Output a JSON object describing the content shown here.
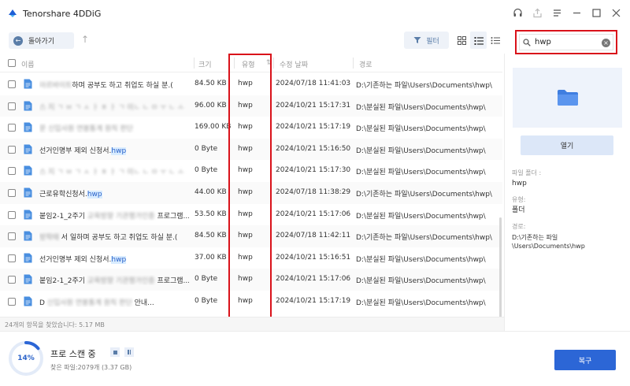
{
  "app": {
    "title": "Tenorshare 4DDiG"
  },
  "toolbar": {
    "back_label": "돌아가기",
    "filter_label": "필터"
  },
  "search": {
    "value": "hwp"
  },
  "table": {
    "headers": {
      "name": "이름",
      "size": "크기",
      "type": "유형",
      "date": "수정 날짜",
      "path": "경로"
    },
    "rows": [
      {
        "name_pre": "",
        "name_blur": "아르바이트",
        "name_post": "하며 공부도 하고 취업도 하실 분.(",
        "hl": "",
        "size": "84.50 KB",
        "type": "hwp",
        "date": "2024/07/18 11:41:03",
        "path": "D:\\기존하는 파일\\Users\\Documents\\hwp\\"
      },
      {
        "name_pre": "",
        "name_blur": "스 지 ㄱ ㅂ ㄱ ㅅ ㅏ ㅎ ㅏ ㄱ 이ㄴ ㄴ ㅁ ㅜ ㄴ ㅗ",
        "name_post": "",
        "hl": "",
        "size": "96.00 KB",
        "type": "hwp",
        "date": "2024/10/21 15:17:31",
        "path": "D:\\분실된 파일\\Users\\Documents\\hwp\\"
      },
      {
        "name_pre": "",
        "name_blur": "문 신입사원 연봉통계 원칙 판단",
        "name_post": "",
        "hl": "",
        "size": "169.00 KB",
        "type": "hwp",
        "date": "2024/10/21 15:17:19",
        "path": "D:\\분실된 파일\\Users\\Documents\\hwp\\"
      },
      {
        "name_pre": "선거인명부 제외 신청서.",
        "name_blur": "",
        "name_post": "",
        "hl": "hwp",
        "size": "0 Byte",
        "type": "hwp",
        "date": "2024/10/21 15:16:50",
        "path": "D:\\분실된 파일\\Users\\Documents\\hwp\\"
      },
      {
        "name_pre": "",
        "name_blur": "스 지 ㄱ ㅂ ㄱ ㅅ ㅏ ㅎ ㅏ ㄱ 이ㄴ ㄴ ㅁ ㅜ ㄴ ㅗ",
        "name_post": "",
        "hl": "",
        "size": "0 Byte",
        "type": "hwp",
        "date": "2024/10/21 15:17:30",
        "path": "D:\\분실된 파일\\Users\\Documents\\hwp\\"
      },
      {
        "name_pre": "근로유학신청서.",
        "name_blur": "",
        "name_post": "",
        "hl": "hwp",
        "size": "44.00 KB",
        "type": "hwp",
        "date": "2024/07/18 11:38:29",
        "path": "D:\\기존하는 파일\\Users\\Documents\\hwp\\"
      },
      {
        "name_pre": "붙임2-1_2주기",
        "name_blur": " 교육방향 기관평가인증",
        "name_post": " 프로그램...",
        "hl": "",
        "size": "53.50 KB",
        "type": "hwp",
        "date": "2024/10/21 15:17:06",
        "path": "D:\\분실된 파일\\Users\\Documents\\hwp\\"
      },
      {
        "name_pre": "",
        "name_blur": "방학때 ",
        "name_post": "서 일하며 공부도 하고 취업도 하실 분.(",
        "hl": "",
        "size": "84.50 KB",
        "type": "hwp",
        "date": "2024/07/18 11:42:11",
        "path": "D:\\기존하는 파일\\Users\\Documents\\hwp\\"
      },
      {
        "name_pre": "선거인명부 제외 신청서.",
        "name_blur": "",
        "name_post": "",
        "hl": "hwp",
        "size": "37.00 KB",
        "type": "hwp",
        "date": "2024/10/21 15:16:51",
        "path": "D:\\분실된 파일\\Users\\Documents\\hwp\\"
      },
      {
        "name_pre": "붙임2-1_2주기",
        "name_blur": " 교육방향 기관평가인증",
        "name_post": " 프로그램...",
        "hl": "",
        "size": "0 Byte",
        "type": "hwp",
        "date": "2024/10/21 15:17:06",
        "path": "D:\\분실된 파일\\Users\\Documents\\hwp\\"
      },
      {
        "name_pre": "D",
        "name_blur": " 신입사원 연봉통계 원칙 판단",
        "name_post": " 안내...",
        "hl": "",
        "size": "0 Byte",
        "type": "hwp",
        "date": "2024/10/21 15:17:19",
        "path": "D:\\분실된 파일\\Users\\Documents\\hwp\\"
      }
    ],
    "count_text": "24개의 항목을 찾았습니다: 5.17 MB"
  },
  "preview": {
    "open_label": "열기",
    "name_label": "파일 폴더 :",
    "name_value": "hwp",
    "type_label": "유형:",
    "type_value": "폴더",
    "path_label": "경로:",
    "path_value": "D:\\기존하는 파일\\Users\\Documents\\hwp"
  },
  "scan": {
    "percent": "14%",
    "progress_fraction": 0.14,
    "title": "프로 스캔 중",
    "found": "찾은 파일:2079개 (3.37 GB)"
  },
  "bottom": {
    "recover_label": "복구"
  },
  "colors": {
    "accent": "#2c66d6",
    "highlight_box": "#d9121a",
    "file_icon": "#4a8fe0"
  }
}
